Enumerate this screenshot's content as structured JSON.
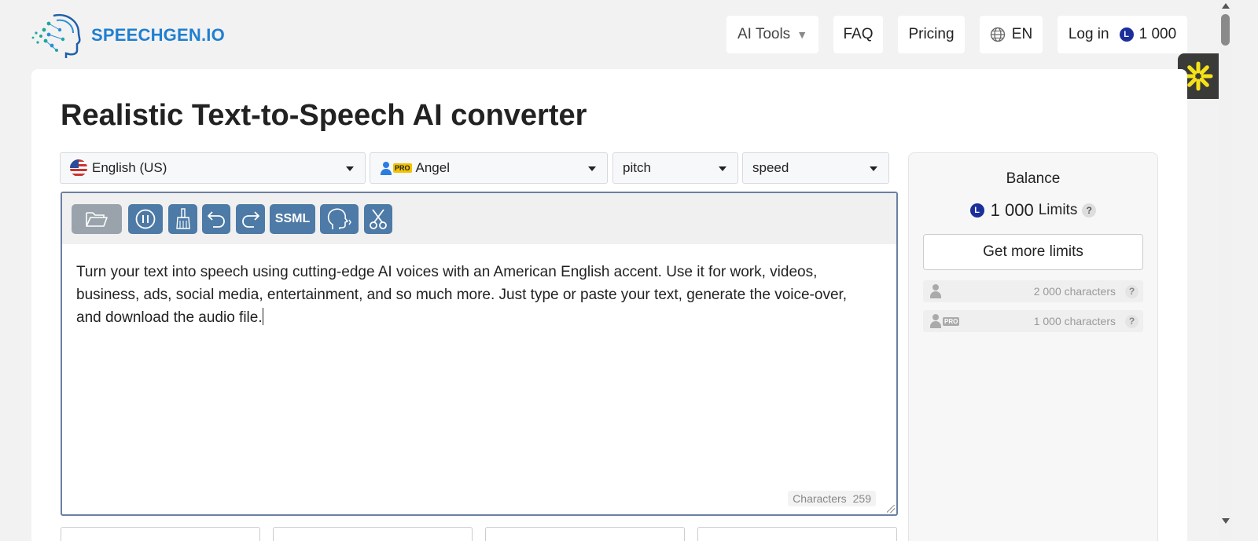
{
  "header": {
    "logo_text": "SPEECHGEN.IO",
    "nav": {
      "ai_tools": "AI Tools",
      "faq": "FAQ",
      "pricing": "Pricing",
      "lang": "EN",
      "login": "Log in",
      "coin_symbol": "L",
      "balance": "1 000"
    }
  },
  "main": {
    "title": "Realistic Text-to-Speech AI converter",
    "selects": {
      "language": "English (US)",
      "voice_badge": "PRO",
      "voice": "Angel",
      "pitch": "pitch",
      "speed": "speed"
    },
    "toolbar": {
      "ssml_label": "SSML"
    },
    "editor": {
      "text": "Turn your text into speech using cutting-edge AI voices with an American English accent. Use it for work, videos, business, ads, social media, entertainment, and so much more. Just type or paste your text, generate the voice-over, and download the audio file.",
      "char_label": "Characters",
      "char_count": "259"
    }
  },
  "balance": {
    "title": "Balance",
    "coin_symbol": "L",
    "amount": "1 000",
    "limits_label": "Limits",
    "help": "?",
    "get_more": "Get more limits",
    "rows": [
      {
        "badge": "",
        "value": "2 000 characters"
      },
      {
        "badge": "PRO",
        "value": "1 000 characters"
      }
    ]
  },
  "colors": {
    "brand": "#1f7fd0",
    "toolbar_button": "#4d7aa6",
    "coin": "#1a2f9a",
    "pro_badge": "#f2c200"
  }
}
